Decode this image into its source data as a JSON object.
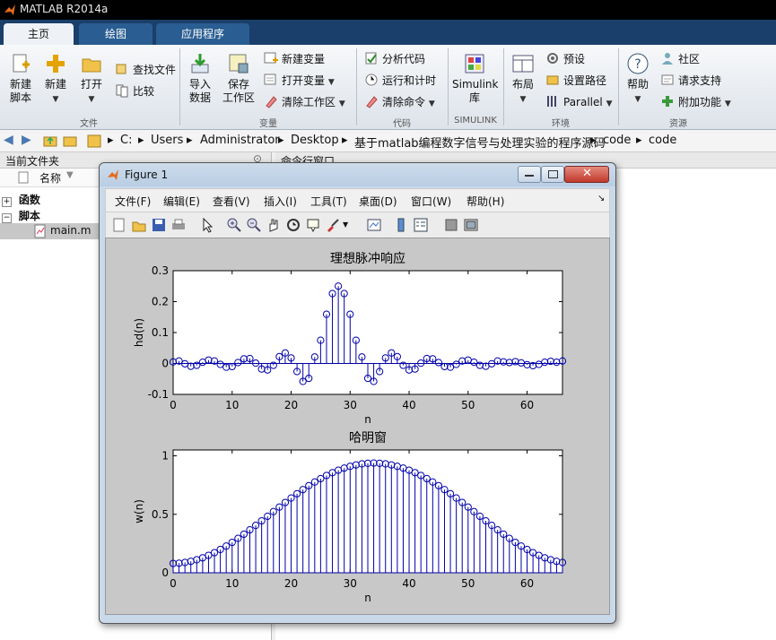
{
  "app": {
    "title": "MATLAB R2014a"
  },
  "tabs": [
    "主页",
    "绘图",
    "应用程序"
  ],
  "ribbon": {
    "file": {
      "new_script": [
        "新建",
        "脚本"
      ],
      "new": "新建",
      "open": "打开",
      "find_files": "查找文件",
      "compare": "比较",
      "group": "文件"
    },
    "variable": {
      "import": [
        "导入",
        "数据"
      ],
      "save": [
        "保存",
        "工作区"
      ],
      "new_var": "新建变量",
      "open_var": "打开变量",
      "clear_ws": "清除工作区",
      "group": "变量"
    },
    "code": {
      "analyze": "分析代码",
      "run_time": "运行和计时",
      "clear_cmd": "清除命令",
      "group": "代码"
    },
    "simulink": {
      "lib": [
        "Simulink",
        "库"
      ],
      "group": "SIMULINK"
    },
    "environment": {
      "layout": "布局",
      "prefs": "预设",
      "set_path": "设置路径",
      "parallel": "Parallel",
      "group": "环境"
    },
    "resources": {
      "help": "帮助",
      "community": "社区",
      "support": "请求支持",
      "addons": "附加功能",
      "group": "资源"
    }
  },
  "address": {
    "crumbs": [
      "C:",
      "Users",
      "Administrator",
      "Desktop",
      "基于matlab编程数字信号与处理实验的程序源码",
      "code",
      "code"
    ]
  },
  "left_panel": {
    "title": "当前文件夹",
    "col_name": "名称",
    "groups": [
      "函数",
      "脚本"
    ],
    "file": "main.m"
  },
  "command_panel": {
    "title": "命令行窗口"
  },
  "figure": {
    "title": "Figure 1",
    "menu": [
      "文件(F)",
      "编辑(E)",
      "查看(V)",
      "插入(I)",
      "工具(T)",
      "桌面(D)",
      "窗口(W)",
      "帮助(H)"
    ]
  },
  "colors": {
    "stem": "#0000aa",
    "canvas": "#c8c8c8",
    "ribbon_tab": "#1a3f6a"
  },
  "chart_data": [
    {
      "type": "stem",
      "title": "理想脉冲响应",
      "xlabel": "n",
      "ylabel": "hd(n)",
      "xlim": [
        0,
        66
      ],
      "ylim": [
        -0.1,
        0.3
      ],
      "xticks": [
        0,
        10,
        20,
        30,
        40,
        50,
        60
      ],
      "yticks": [
        -0.1,
        0,
        0.1,
        0.2,
        0.3
      ],
      "ytick_labels": [
        "-0.1",
        "0",
        "0.1",
        "0.2",
        "0.3"
      ],
      "x": [
        0,
        1,
        2,
        3,
        4,
        5,
        6,
        7,
        8,
        9,
        10,
        11,
        12,
        13,
        14,
        15,
        16,
        17,
        18,
        19,
        20,
        21,
        22,
        23,
        24,
        25,
        26,
        27,
        28,
        29,
        30,
        31,
        32,
        33,
        34,
        35,
        36,
        37,
        38,
        39,
        40,
        41,
        42,
        43,
        44,
        45,
        46,
        47,
        48,
        49,
        50,
        51,
        52,
        53,
        54,
        55,
        56,
        57,
        58,
        59,
        60,
        61,
        62,
        63,
        64,
        65,
        66
      ],
      "values": [
        0.005,
        0.008,
        -0.001,
        -0.009,
        -0.006,
        0.004,
        0.011,
        0.008,
        -0.003,
        -0.012,
        -0.01,
        0.003,
        0.015,
        0.016,
        0.001,
        -0.018,
        -0.021,
        -0.006,
        0.022,
        0.034,
        0.018,
        -0.026,
        -0.058,
        -0.048,
        0.021,
        0.075,
        0.159,
        0.226,
        0.25,
        0.226,
        0.159,
        0.075,
        0.021,
        -0.048,
        -0.058,
        -0.026,
        0.018,
        0.034,
        0.022,
        -0.006,
        -0.021,
        -0.018,
        0.001,
        0.016,
        0.015,
        0.003,
        -0.01,
        -0.012,
        -0.003,
        0.008,
        0.011,
        0.004,
        -0.006,
        -0.009,
        -0.001,
        0.008,
        0.005,
        0.003,
        0.006,
        0.002,
        -0.004,
        -0.007,
        -0.003,
        0.004,
        0.007,
        0.004,
        0.008
      ]
    },
    {
      "type": "stem",
      "title": "哈明窗",
      "xlabel": "n",
      "ylabel": "w(n)",
      "xlim": [
        0,
        66
      ],
      "ylim": [
        0,
        1.05
      ],
      "xticks": [
        0,
        10,
        20,
        30,
        40,
        50,
        60
      ],
      "yticks": [
        0,
        0.5,
        1
      ],
      "ytick_labels": [
        "0",
        "0.5",
        "1"
      ],
      "x": [
        0,
        1,
        2,
        3,
        4,
        5,
        6,
        7,
        8,
        9,
        10,
        11,
        12,
        13,
        14,
        15,
        16,
        17,
        18,
        19,
        20,
        21,
        22,
        23,
        24,
        25,
        26,
        27,
        28,
        29,
        30,
        31,
        32,
        33,
        34,
        35,
        36,
        37,
        38,
        39,
        40,
        41,
        42,
        43,
        44,
        45,
        46,
        47,
        48,
        49,
        50,
        51,
        52,
        53,
        54,
        55,
        56,
        57,
        58,
        59,
        60,
        61,
        62,
        63,
        64,
        65,
        66
      ],
      "values": [
        0.08,
        0.082,
        0.088,
        0.098,
        0.111,
        0.128,
        0.149,
        0.172,
        0.199,
        0.228,
        0.26,
        0.294,
        0.33,
        0.367,
        0.405,
        0.444,
        0.483,
        0.523,
        0.562,
        0.601,
        0.639,
        0.676,
        0.711,
        0.745,
        0.776,
        0.805,
        0.832,
        0.856,
        0.877,
        0.895,
        0.91,
        0.922,
        0.931,
        0.936,
        0.938,
        0.936,
        0.931,
        0.922,
        0.91,
        0.895,
        0.877,
        0.856,
        0.832,
        0.805,
        0.776,
        0.745,
        0.711,
        0.676,
        0.639,
        0.601,
        0.562,
        0.523,
        0.483,
        0.444,
        0.405,
        0.367,
        0.33,
        0.294,
        0.26,
        0.228,
        0.199,
        0.172,
        0.149,
        0.128,
        0.111,
        0.098,
        0.088
      ]
    }
  ]
}
